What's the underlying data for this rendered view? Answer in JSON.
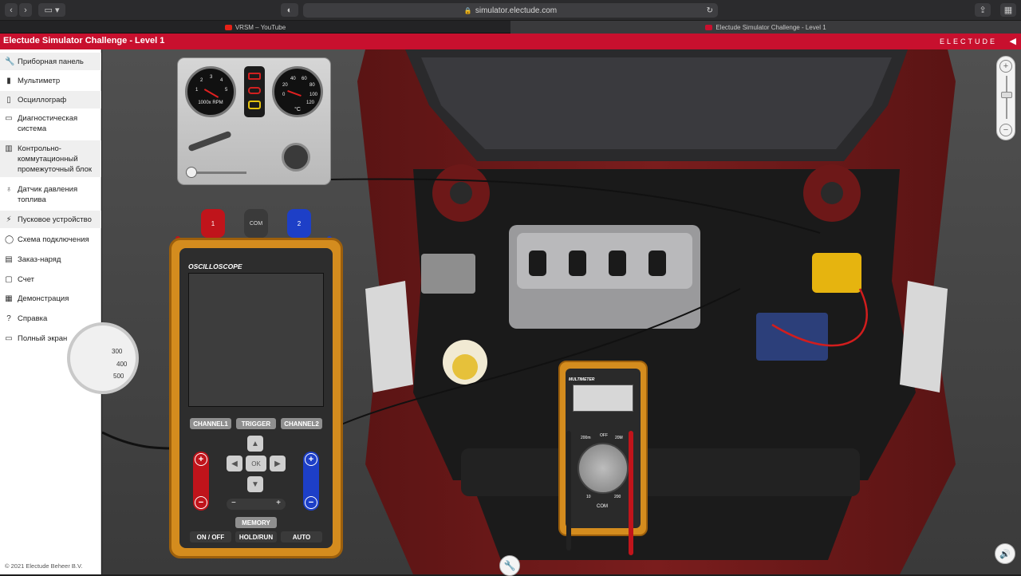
{
  "browser": {
    "url": "simulator.electude.com",
    "tabs": [
      {
        "label": "VRSM – YouTube",
        "active": false
      },
      {
        "label": "Electude Simulator Challenge - Level 1",
        "active": true
      }
    ]
  },
  "app": {
    "title": "Electude Simulator Challenge - Level 1",
    "brand": "ELECTUDE",
    "accent_color": "#c8102e"
  },
  "sidebar": {
    "items": [
      {
        "label": "Приборная панель",
        "icon": "wrench-icon"
      },
      {
        "label": "Мультиметр",
        "icon": "multimeter-icon"
      },
      {
        "label": "Осциллограф",
        "icon": "oscilloscope-icon"
      },
      {
        "label": "Диагностическая система",
        "icon": "monitor-icon"
      },
      {
        "label": "Контрольно-коммутационный промежуточный блок",
        "icon": "breakout-box-icon"
      },
      {
        "label": "Датчик давления топлива",
        "icon": "pressure-sensor-icon"
      },
      {
        "label": "Пусковое устройство",
        "icon": "lightning-icon"
      },
      {
        "label": "Схема подключения",
        "icon": "bulb-icon"
      },
      {
        "label": "Заказ-наряд",
        "icon": "document-icon"
      },
      {
        "label": "Счет",
        "icon": "invoice-icon"
      },
      {
        "label": "Демонстрация",
        "icon": "film-icon"
      },
      {
        "label": "Справка",
        "icon": "help-icon"
      },
      {
        "label": "Полный экран",
        "icon": "fullscreen-icon"
      }
    ],
    "copyright": "© 2021 Electude Beheer B.V."
  },
  "dashboard": {
    "rpm_gauge": {
      "ticks": [
        "1",
        "2",
        "3",
        "4",
        "5",
        "6",
        "7"
      ],
      "unit": "1000x RPM"
    },
    "temp_gauge": {
      "ticks": [
        "0",
        "20",
        "40",
        "60",
        "80",
        "100",
        "120"
      ],
      "unit": "°C"
    }
  },
  "oscilloscope": {
    "title": "OSCILLOSCOPE",
    "probe_com": "COM",
    "probe_1": "1",
    "probe_2": "2",
    "buttons": {
      "channel1": "CHANNEL1",
      "trigger": "TRIGGER",
      "channel2": "CHANNEL2",
      "ok": "OK",
      "memory": "MEMORY",
      "onoff": "ON / OFF",
      "holdrun": "HOLD/RUN",
      "auto": "AUTO"
    }
  },
  "multimeter": {
    "title": "MULTIMETER",
    "com_label": "COM",
    "range_labels": [
      "200m",
      "OFF",
      "20M",
      "10",
      "200"
    ]
  },
  "pressure_gauge": {
    "ticks": [
      "300",
      "400",
      "500"
    ]
  }
}
